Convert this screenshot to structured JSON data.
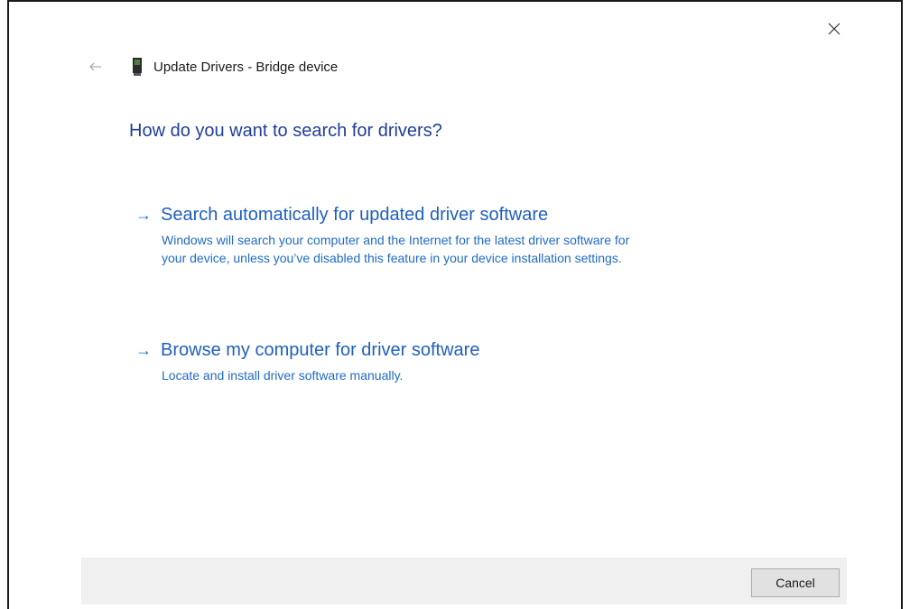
{
  "window": {
    "title": "Update Drivers - Bridge device"
  },
  "icons": {
    "close": "close-icon",
    "back": "back-arrow-icon",
    "device": "device-icon",
    "option_arrow": "right-arrow-icon"
  },
  "main": {
    "question": "How do you want to search for drivers?",
    "options": [
      {
        "arrow": "→",
        "title": "Search automatically for updated driver software",
        "description_line1": "Windows will search your computer and the Internet for the latest driver software for",
        "description_line2": "your device, unless you’ve disabled this feature in your device installation settings."
      },
      {
        "arrow": "→",
        "title": "Browse my computer for driver software",
        "description_line1": "Locate and install driver software manually."
      }
    ]
  },
  "footer": {
    "cancel_label": "Cancel"
  },
  "colors": {
    "heading_blue": "#1f3e9d",
    "link_blue": "#1f5fbf",
    "footer_bg": "#f0f0f0"
  }
}
